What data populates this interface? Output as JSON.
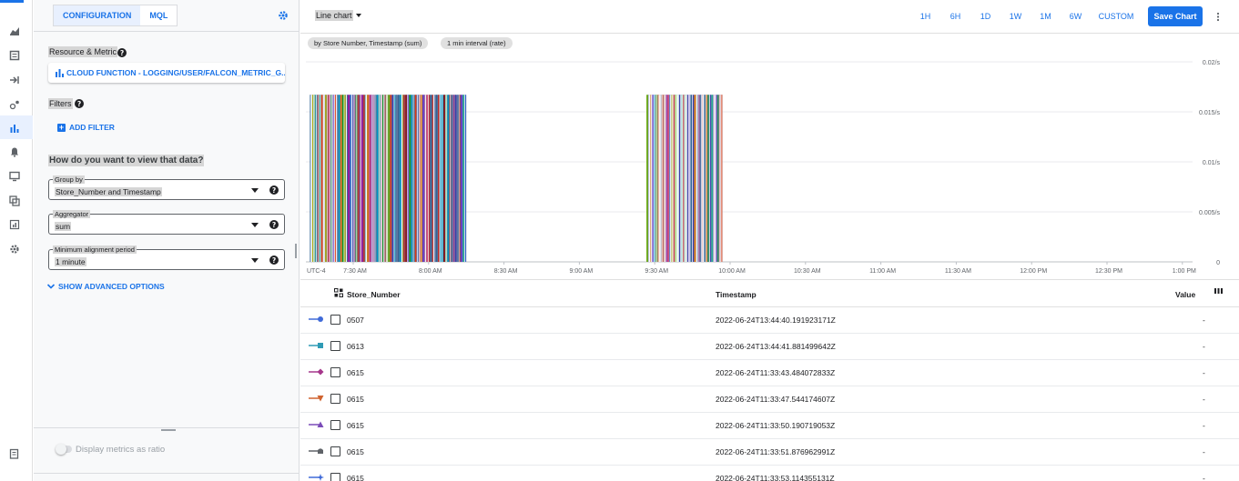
{
  "config_panel": {
    "tabs": [
      {
        "label": "CONFIGURATION",
        "selected": true
      },
      {
        "label": "MQL",
        "selected": false
      }
    ],
    "resource_metric": {
      "label": "Resource & Metric",
      "button_label": "CLOUD FUNCTION - LOGGING/USER/FALCON_METRIC_G..."
    },
    "filters": {
      "label": "Filters",
      "add_label": "ADD FILTER"
    },
    "view_question": "How do you want to view that data?",
    "group_by": {
      "label": "Group by",
      "value": "Store_Number and Timestamp"
    },
    "aggregator": {
      "label": "Aggregator",
      "value": "sum"
    },
    "min_alignment": {
      "label": "Minimum alignment period",
      "value": "1 minute"
    },
    "advanced_label": "SHOW ADVANCED OPTIONS",
    "ratio_label": "Display metrics as ratio"
  },
  "toolbar": {
    "chart_type": "Line chart",
    "ranges": [
      "1H",
      "6H",
      "1D",
      "1W",
      "1M",
      "6W",
      "CUSTOM"
    ],
    "save_label": "Save Chart"
  },
  "chips": [
    "by Store Number, Timestamp (sum)",
    "1 min interval (rate)"
  ],
  "chart_data": {
    "type": "line",
    "timezone_label": "UTC-4",
    "x_tick_labels": [
      "7:30 AM",
      "8:00 AM",
      "8:30 AM",
      "9:00 AM",
      "9:30 AM",
      "10:00 AM",
      "10:30 AM",
      "11:00 AM",
      "11:30 AM",
      "12:00 PM",
      "12:30 PM",
      "1:00 PM"
    ],
    "y_tick_labels": [
      "0.02/s",
      "0.015/s",
      "0.01/s",
      "0.005/s",
      "0"
    ],
    "ylim": [
      0,
      0.02
    ],
    "grid": true,
    "activity_windows": [
      {
        "start": "7:13 AM",
        "end": "8:15 AM",
        "level": 0.0167
      },
      {
        "start": "9:27 AM",
        "end": "9:57 AM",
        "level": 0.0167
      }
    ],
    "series_colors": [
      "#3366cc",
      "#dc3912",
      "#109618",
      "#990099",
      "#0099c6",
      "#dd4477",
      "#66aa00",
      "#b82e2e",
      "#316395",
      "#22aa99",
      "#aaaa11",
      "#6633cc",
      "#e67300",
      "#8b0707",
      "#329262",
      "#5574a6",
      "#3b3eac",
      "#994499"
    ]
  },
  "table": {
    "columns": {
      "store": "Store_Number",
      "timestamp": "Timestamp",
      "value": "Value"
    },
    "rows": [
      {
        "store": "0507",
        "timestamp": "2022-06-24T13:44:40.191923171Z",
        "value": "-",
        "color": "#3f6ad8",
        "marker": "circle"
      },
      {
        "store": "0613",
        "timestamp": "2022-06-24T13:44:41.881499642Z",
        "value": "-",
        "color": "#2f9bb5",
        "marker": "square"
      },
      {
        "store": "0615",
        "timestamp": "2022-06-24T11:33:43.484072833Z",
        "value": "-",
        "color": "#a6378c",
        "marker": "diamond"
      },
      {
        "store": "0615",
        "timestamp": "2022-06-24T11:33:47.544174607Z",
        "value": "-",
        "color": "#d0632f",
        "marker": "triangle-down"
      },
      {
        "store": "0615",
        "timestamp": "2022-06-24T11:33:50.190719053Z",
        "value": "-",
        "color": "#7a4bb8",
        "marker": "triangle-up"
      },
      {
        "store": "0615",
        "timestamp": "2022-06-24T11:33:51.876962991Z",
        "value": "-",
        "color": "#5f6368",
        "marker": "pentagon"
      },
      {
        "store": "0615",
        "timestamp": "2022-06-24T11:33:53.114355131Z",
        "value": "-",
        "color": "#3f6ad8",
        "marker": "star"
      }
    ]
  }
}
